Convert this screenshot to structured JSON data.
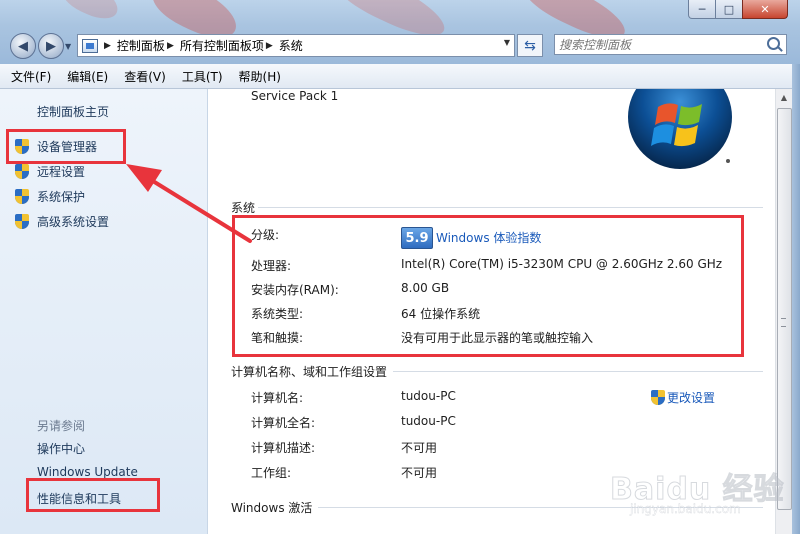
{
  "window": {
    "caption_min": "─",
    "caption_max": "□",
    "caption_close": "✕"
  },
  "address": {
    "crumbs": [
      "控制面板",
      "所有控制面板项",
      "系统"
    ],
    "search_placeholder": "搜索控制面板"
  },
  "menu": [
    "文件(F)",
    "编辑(E)",
    "查看(V)",
    "工具(T)",
    "帮助(H)"
  ],
  "sidebar": {
    "home": "控制面板主页",
    "items": [
      "设备管理器",
      "远程设置",
      "系统保护",
      "高级系统设置"
    ],
    "see_also_title": "另请参阅",
    "see_also": [
      "操作中心",
      "Windows Update",
      "性能信息和工具"
    ]
  },
  "main": {
    "service_pack": "Service Pack 1",
    "system_section": {
      "title": "系统",
      "rating_label": "分级:",
      "rating_score": "5.9",
      "rating_link": "Windows 体验指数",
      "rows": [
        {
          "label": "处理器:",
          "value": "Intel(R) Core(TM) i5-3230M CPU @ 2.60GHz   2.60 GHz"
        },
        {
          "label": "安装内存(RAM):",
          "value": "8.00 GB"
        },
        {
          "label": "系统类型:",
          "value": "64 位操作系统"
        },
        {
          "label": "笔和触摸:",
          "value": "没有可用于此显示器的笔或触控输入"
        }
      ]
    },
    "computer_section": {
      "title": "计算机名称、域和工作组设置",
      "change_link": "更改设置",
      "rows": [
        {
          "label": "计算机名:",
          "value": "tudou-PC"
        },
        {
          "label": "计算机全名:",
          "value": "tudou-PC"
        },
        {
          "label": "计算机描述:",
          "value": "不可用"
        },
        {
          "label": "工作组:",
          "value": "不可用"
        }
      ]
    },
    "activation_section": {
      "title": "Windows 激活"
    }
  },
  "watermark": {
    "brand": "Baidu 经验",
    "url": "jingyan.baidu.com"
  },
  "colors": {
    "annotation_red": "#e8343c",
    "link_blue": "#1a5aba"
  }
}
